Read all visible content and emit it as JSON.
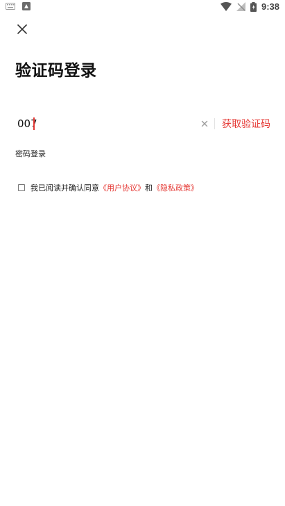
{
  "status_bar": {
    "time": "9:38",
    "icons": [
      "keyboard-icon",
      "notification-icon",
      "wifi-icon",
      "signal-icon",
      "battery-icon"
    ]
  },
  "colors": {
    "accent": "#e53935",
    "text": "#222222",
    "title": "#111111"
  },
  "header": {
    "close_icon": "close-icon"
  },
  "page": {
    "title": "验证码登录"
  },
  "login_form": {
    "phone_value": "007",
    "get_code_label": "获取验证码",
    "password_login_label": "密码登录"
  },
  "agreement": {
    "prefix": "我已阅读并确认同意",
    "user_agreement": "《用户协议》",
    "conjunction": "和",
    "privacy_policy": "《隐私政策》",
    "checked": false
  }
}
